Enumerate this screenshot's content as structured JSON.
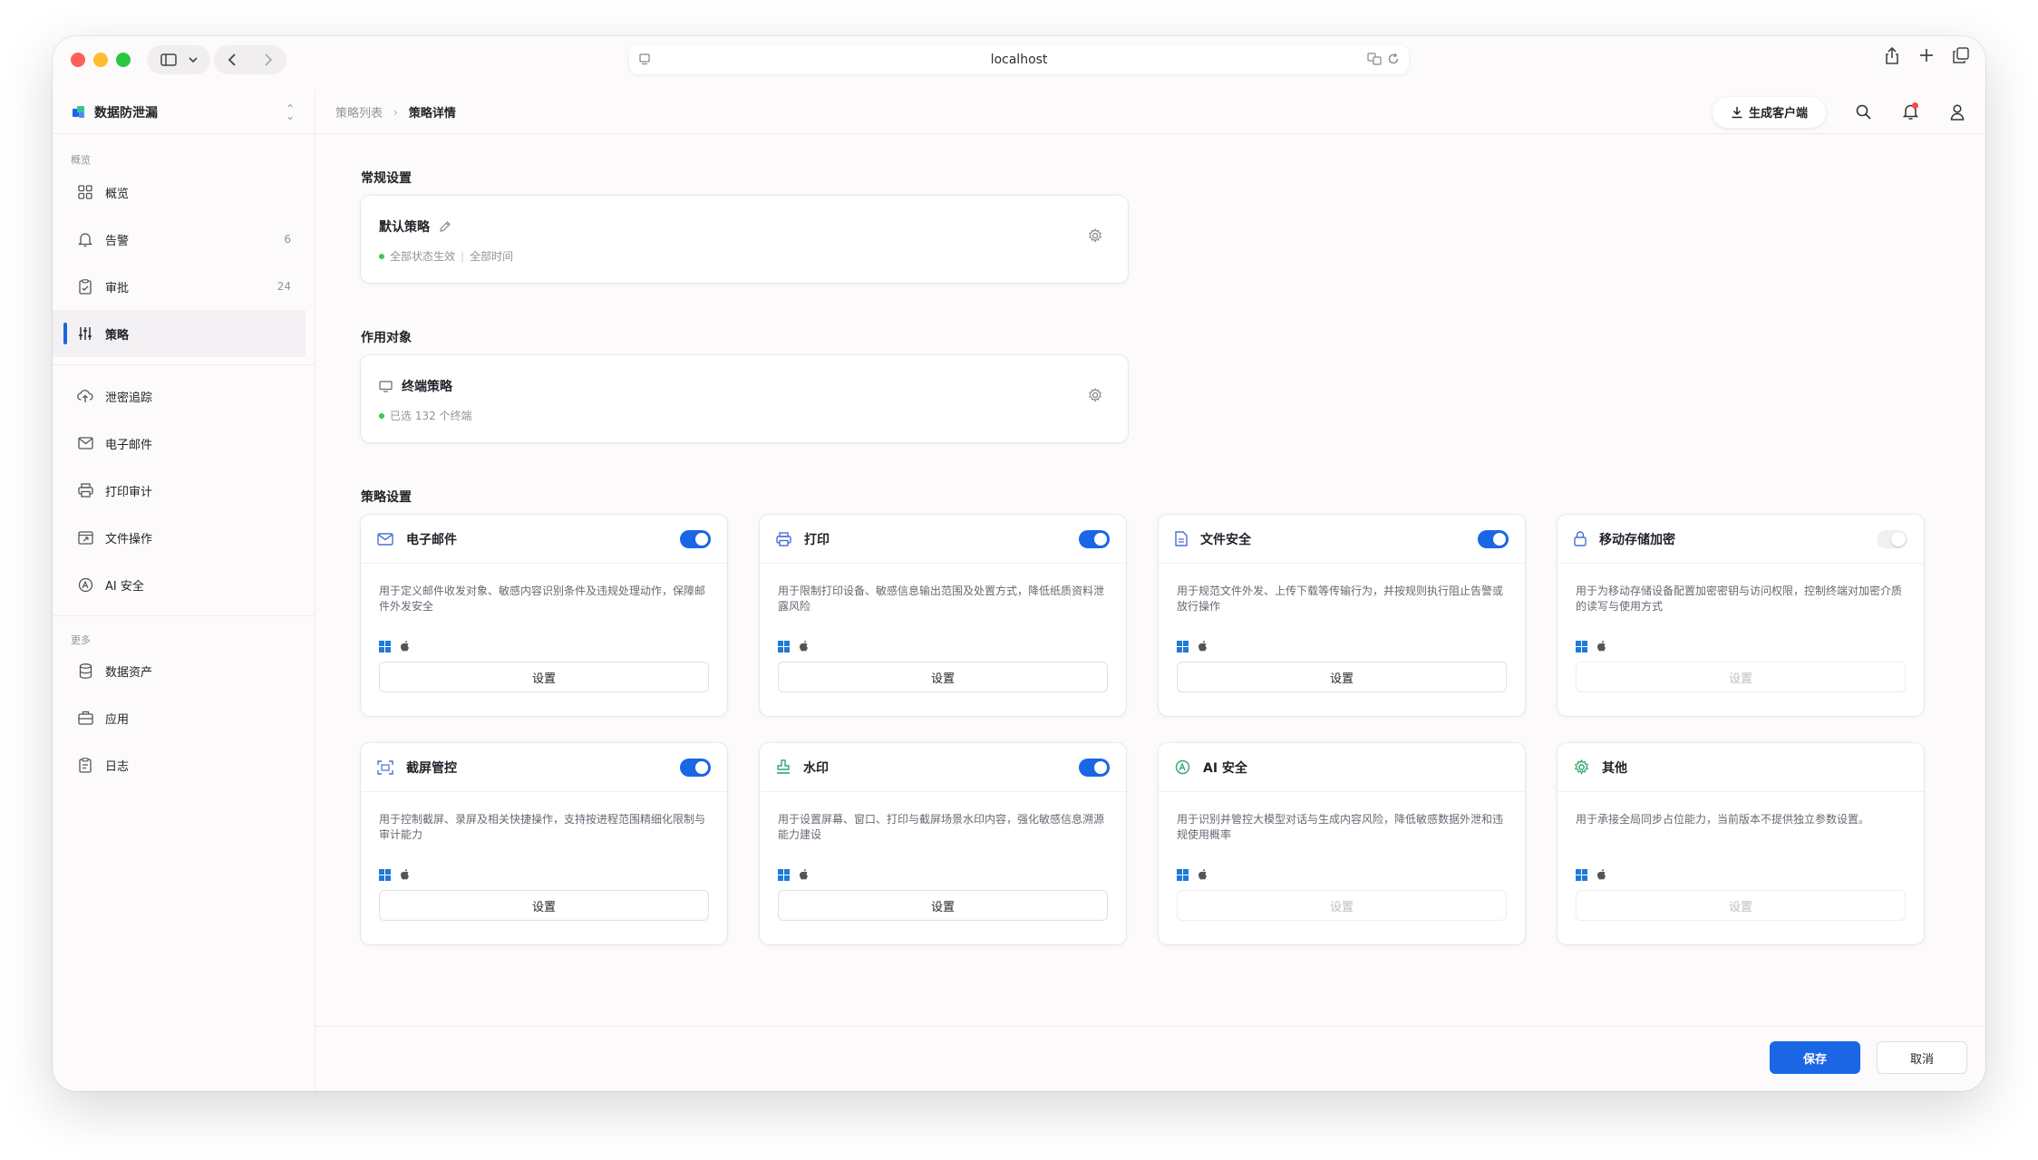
{
  "browser": {
    "url": "localhost"
  },
  "brand": {
    "name": "数据防泄漏"
  },
  "sidebar": {
    "group_overview": "概览",
    "group_more": "更多",
    "items": [
      {
        "label": "概览",
        "icon": "grid-icon"
      },
      {
        "label": "告警",
        "icon": "bell-icon",
        "count": "6"
      },
      {
        "label": "审批",
        "icon": "approval-icon",
        "count": "24"
      },
      {
        "label": "策略",
        "icon": "sliders-icon"
      },
      {
        "label": "泄密追踪",
        "icon": "cloud-trace-icon"
      },
      {
        "label": "电子邮件",
        "icon": "mail-icon"
      },
      {
        "label": "打印审计",
        "icon": "printer-icon"
      },
      {
        "label": "文件操作",
        "icon": "file-op-icon"
      },
      {
        "label": "AI 安全",
        "icon": "ai-icon"
      },
      {
        "label": "数据资产",
        "icon": "database-icon"
      },
      {
        "label": "应用",
        "icon": "app-icon"
      },
      {
        "label": "日志",
        "icon": "log-icon"
      }
    ]
  },
  "breadcrumb": {
    "parent": "策略列表",
    "current": "策略详情"
  },
  "topbar": {
    "generate_client": "生成客户端"
  },
  "sections": {
    "general": "常规设置",
    "target": "作用对象",
    "policy": "策略设置"
  },
  "general_card": {
    "title": "默认策略",
    "status": "全部状态生效",
    "time": "全部时间"
  },
  "target_card": {
    "title": "终端策略",
    "status": "已选 132 个终端"
  },
  "policy_cards": [
    {
      "label": "电子邮件",
      "icon": "mail-icon",
      "enabled": true,
      "desc": "用于定义邮件收发对象、敏感内容识别条件及违规处理动作，保障邮件外发安全",
      "button": "设置"
    },
    {
      "label": "打印",
      "icon": "printer-icon",
      "enabled": true,
      "desc": "用于限制打印设备、敏感信息输出范围及处置方式，降低纸质资料泄露风险",
      "button": "设置"
    },
    {
      "label": "文件安全",
      "icon": "file-icon",
      "enabled": true,
      "desc": "用于规范文件外发、上传下载等传输行为，并按规则执行阻止告警或放行操作",
      "button": "设置"
    },
    {
      "label": "移动存储加密",
      "icon": "lock-icon",
      "enabled": false,
      "desc": "用于为移动存储设备配置加密密钥与访问权限，控制终端对加密介质的读写与使用方式",
      "button": "设置"
    },
    {
      "label": "截屏管控",
      "icon": "screenshot-icon",
      "enabled": true,
      "desc": "用于控制截屏、录屏及相关快捷操作，支持按进程范围精细化限制与审计能力",
      "button": "设置"
    },
    {
      "label": "水印",
      "icon": "stamp-icon",
      "enabled": true,
      "desc": "用于设置屏幕、窗口、打印与截屏场景水印内容，强化敏感信息溯源能力建设",
      "button": "设置"
    },
    {
      "label": "AI 安全",
      "icon": "ai-icon",
      "enabled": null,
      "desc": "用于识别并管控大模型对话与生成内容风险，降低敏感数据外泄和违规使用概率",
      "button": "设置"
    },
    {
      "label": "其他",
      "icon": "gear-icon",
      "enabled": null,
      "desc": "用于承接全局同步占位能力，当前版本不提供独立参数设置。",
      "button": "设置"
    }
  ],
  "footer": {
    "save": "保存",
    "cancel": "取消"
  },
  "colors": {
    "accent": "#1a66e5",
    "status_green": "#34c759",
    "windows_blue": "#1f7ad8"
  }
}
